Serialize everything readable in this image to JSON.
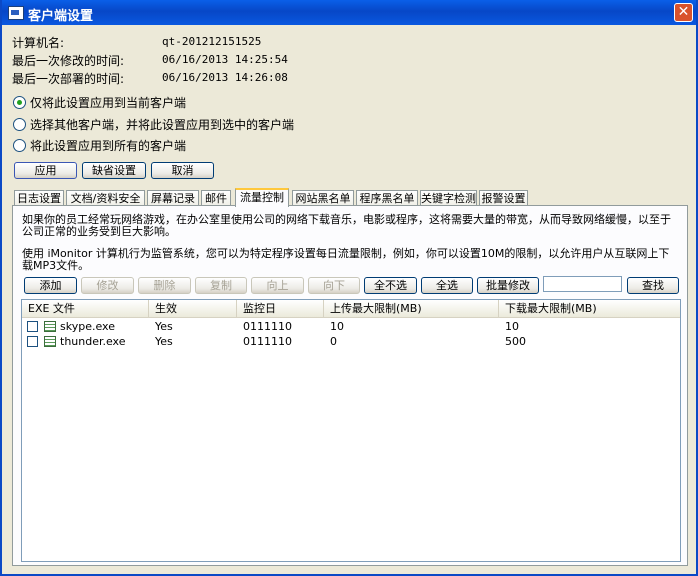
{
  "window": {
    "title": "客户端设置",
    "close_glyph": "✕"
  },
  "info": [
    {
      "label": "计算机名:",
      "value": "qt-201212151525"
    },
    {
      "label": "最后一次修改的时间:",
      "value": "06/16/2013 14:25:54"
    },
    {
      "label": "最后一次部署的时间:",
      "value": "06/16/2013 14:26:08"
    }
  ],
  "scope_options": [
    {
      "label": "仅将此设置应用到当前客户端",
      "selected": true
    },
    {
      "label": "选择其他客户端，并将此设置应用到选中的客户端",
      "selected": false
    },
    {
      "label": "将此设置应用到所有的客户端",
      "selected": false
    }
  ],
  "actions": {
    "apply": "应用",
    "default": "缺省设置",
    "cancel": "取消"
  },
  "tabs": [
    "日志设置",
    "文档/资料安全",
    "屏幕记录",
    "邮件",
    "流量控制",
    "网站黑名单",
    "程序黑名单",
    "关键字检测",
    "报警设置"
  ],
  "active_tab": "流量控制",
  "panel": {
    "desc1": "如果你的员工经常玩网络游戏，在办公室里使用公司的网络下载音乐，电影或程序，这将需要大量的带宽，从而导致网络缓慢，以至于公司正常的业务受到巨大影响。",
    "desc2": "使用 iMonitor 计算机行为监管系统，您可以为特定程序设置每日流量限制，例如，你可以设置10M的限制，以允许用户从互联网上下载MP3文件。",
    "toolbar": {
      "add": "添加",
      "edit": "修改",
      "delete": "删除",
      "copy": "复制",
      "up": "向上",
      "down": "向下",
      "deselect_all": "全不选",
      "select_all": "全选",
      "batch_edit": "批量修改",
      "search_value": "",
      "search": "查找"
    },
    "table": {
      "columns": [
        "EXE 文件",
        "生效",
        "监控日",
        "上传最大限制(MB)",
        "下载最大限制(MB)"
      ],
      "rows": [
        {
          "exe": "skype.exe",
          "enabled": "Yes",
          "days": "0111110",
          "upload": "10",
          "download": "10"
        },
        {
          "exe": "thunder.exe",
          "enabled": "Yes",
          "days": "0111110",
          "upload": "0",
          "download": "500"
        }
      ]
    }
  }
}
